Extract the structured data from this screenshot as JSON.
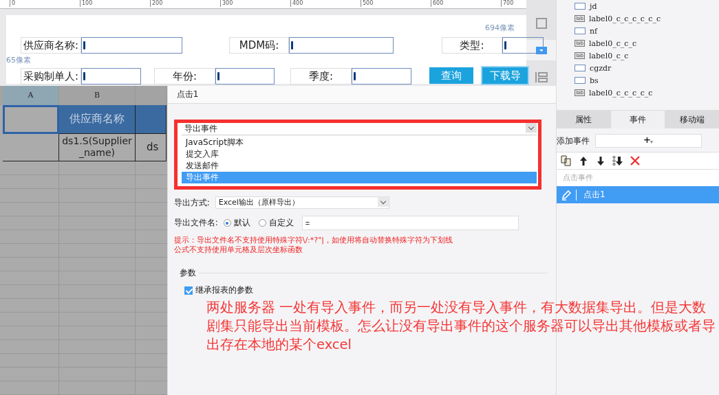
{
  "ruler": {
    "ticks": [
      "0",
      "100",
      "200",
      "300",
      "400",
      "500",
      "600",
      "700"
    ]
  },
  "canvas": {
    "size_hints": [
      "694像素",
      "65像素"
    ],
    "fields": [
      {
        "label": "供应商名称:"
      },
      {
        "label": "MDM码:"
      },
      {
        "label": "类型:"
      },
      {
        "label": "采购制单人:"
      },
      {
        "label": "年份:"
      },
      {
        "label": "季度:"
      }
    ],
    "buttons": [
      {
        "label": "查询",
        "selected": false
      },
      {
        "label": "下载导",
        "selected": true
      }
    ]
  },
  "tree": {
    "items": [
      {
        "kind": "field",
        "name": "jd"
      },
      {
        "kind": "label",
        "badge": "lab",
        "name": "label0_c_c_c_c_c_c"
      },
      {
        "kind": "field",
        "name": "nf"
      },
      {
        "kind": "label",
        "badge": "lab",
        "name": "label0_c_c_c"
      },
      {
        "kind": "label",
        "badge": "lab",
        "name": "label0_c_c"
      },
      {
        "kind": "field",
        "name": "cgzdr"
      },
      {
        "kind": "field",
        "name": "bs"
      },
      {
        "kind": "label",
        "badge": "lab",
        "name": "label0_c_c_c_c_c"
      }
    ]
  },
  "sheet": {
    "columns": [
      {
        "label": "A",
        "selected": true
      },
      {
        "label": "B",
        "selected": false
      }
    ],
    "rows": [
      [
        "",
        "供应商名称",
        ""
      ],
      [
        "",
        "ds1.S(Supplier_name)",
        "ds"
      ]
    ]
  },
  "dialog": {
    "title": "点击1",
    "event_type": {
      "value": "导出事件",
      "options": [
        {
          "label": "JavaScript脚本",
          "selected": false
        },
        {
          "label": "提交入库",
          "selected": false
        },
        {
          "label": "发送邮件",
          "selected": false
        },
        {
          "label": "导出事件",
          "selected": true
        }
      ]
    },
    "export_mode": {
      "label": "导出方式:",
      "value": "Excel输出（原样导出）"
    },
    "file_name": {
      "label": "导出文件名:",
      "options": [
        {
          "label": "默认",
          "selected": true
        },
        {
          "label": "自定义",
          "selected": false
        }
      ],
      "value": "="
    },
    "hints": [
      "提示：导出文件名不支持使用特殊字符\\/:*?\"|，如使用将自动替换特殊字符为下划线",
      "公式不支持使用单元格及层次坐标函数"
    ],
    "params": {
      "title": "参数",
      "inherit": {
        "label": "继承报表的参数",
        "checked": true
      }
    }
  },
  "panel": {
    "tabs": [
      {
        "label": "属性",
        "selected": false
      },
      {
        "label": "事件",
        "selected": true
      },
      {
        "label": "移动端",
        "selected": false
      }
    ],
    "add_event": {
      "label": "添加事件",
      "button": "+",
      "caret": "▾"
    },
    "list_header": "点击事件",
    "events": [
      {
        "label": "点击1",
        "selected": true
      }
    ]
  },
  "annotation": "两处服务器 一处有导入事件，而另一处没有导入事件，有大数据集导出。但是大数剧集只能导出当前模板。怎么让没有导出事件的这个服务器可以导出其他模板或者导出存在本地的某个excel"
}
